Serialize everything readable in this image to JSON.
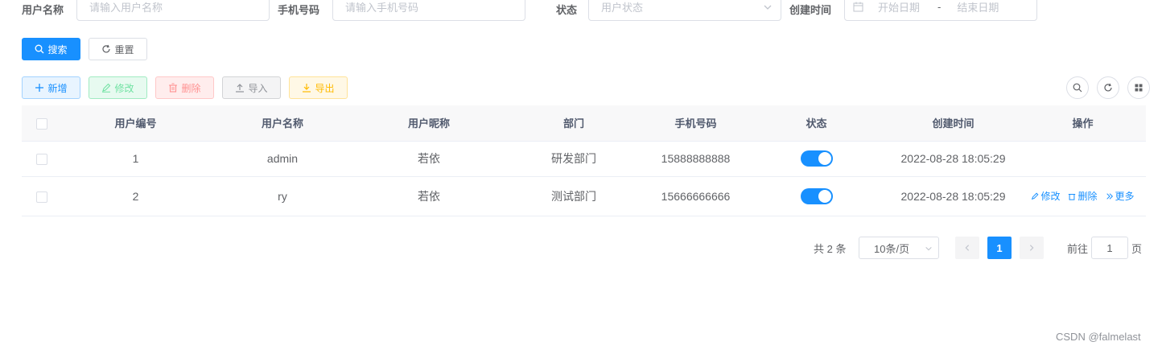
{
  "search": {
    "username_label": "用户名称",
    "username_placeholder": "请输入用户名称",
    "phone_label": "手机号码",
    "phone_placeholder": "请输入手机号码",
    "status_label": "状态",
    "status_placeholder": "用户状态",
    "created_label": "创建时间",
    "start_placeholder": "开始日期",
    "range_sep": "-",
    "end_placeholder": "结束日期",
    "search_btn": "搜索",
    "reset_btn": "重置"
  },
  "toolbar": {
    "add": "新增",
    "edit": "修改",
    "delete": "删除",
    "import": "导入",
    "export": "导出",
    "right_icons": [
      "search-icon",
      "refresh-icon",
      "grid-icon"
    ]
  },
  "table": {
    "headers": [
      "用户编号",
      "用户名称",
      "用户昵称",
      "部门",
      "手机号码",
      "状态",
      "创建时间",
      "操作"
    ],
    "rows": [
      {
        "id": "1",
        "username": "admin",
        "nickname": "若依",
        "dept": "研发部门",
        "phone": "15888888888",
        "status": true,
        "created": "2022-08-28 18:05:29",
        "actions": []
      },
      {
        "id": "2",
        "username": "ry",
        "nickname": "若依",
        "dept": "测试部门",
        "phone": "15666666666",
        "status": true,
        "created": "2022-08-28 18:05:29",
        "actions": [
          "修改",
          "删除",
          "更多"
        ]
      }
    ]
  },
  "pagination": {
    "total_text": "共 2 条",
    "page_size": "10条/页",
    "current_page": "1",
    "goto_label": "前往",
    "goto_value": "1",
    "page_suffix": "页"
  },
  "watermark": "CSDN @falmelast",
  "colors": {
    "primary": "#1890ff",
    "success": "#13ce66",
    "danger": "#ff4949",
    "warning": "#ffba00",
    "info": "#909399"
  }
}
